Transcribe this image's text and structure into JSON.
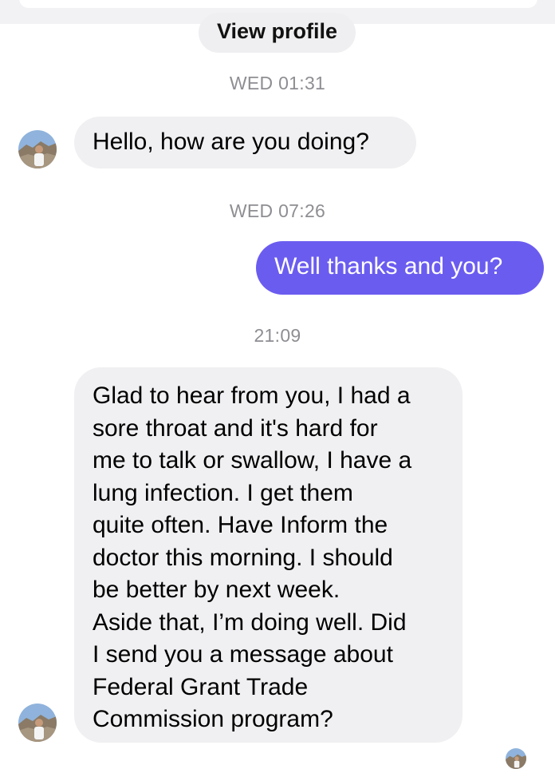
{
  "header": {
    "view_profile_label": "View profile"
  },
  "timestamps": [
    "WED 01:31",
    "WED 07:26",
    "21:09"
  ],
  "messages": [
    {
      "direction": "incoming",
      "text": "Hello, how are you doing?"
    },
    {
      "direction": "outgoing",
      "text": "Well thanks and you?"
    },
    {
      "direction": "incoming",
      "lines": [
        "Glad to hear from you, I had a",
        "sore throat and it's hard for",
        "me to talk or swallow, I have a",
        "lung infection. I get them",
        "quite often. Have Inform the",
        "doctor this morning. I should",
        "be better by next week.",
        "Aside that, I’m doing well. Did",
        "I send you a message about",
        "Federal Grant Trade",
        "Commission program?"
      ]
    }
  ],
  "colors": {
    "outgoing_bubble": "#6b5cf0",
    "incoming_bubble": "#f0f0f2",
    "timestamp_text": "#8e8e93"
  },
  "icons": {
    "contact_avatar": "contact-avatar-photo"
  }
}
